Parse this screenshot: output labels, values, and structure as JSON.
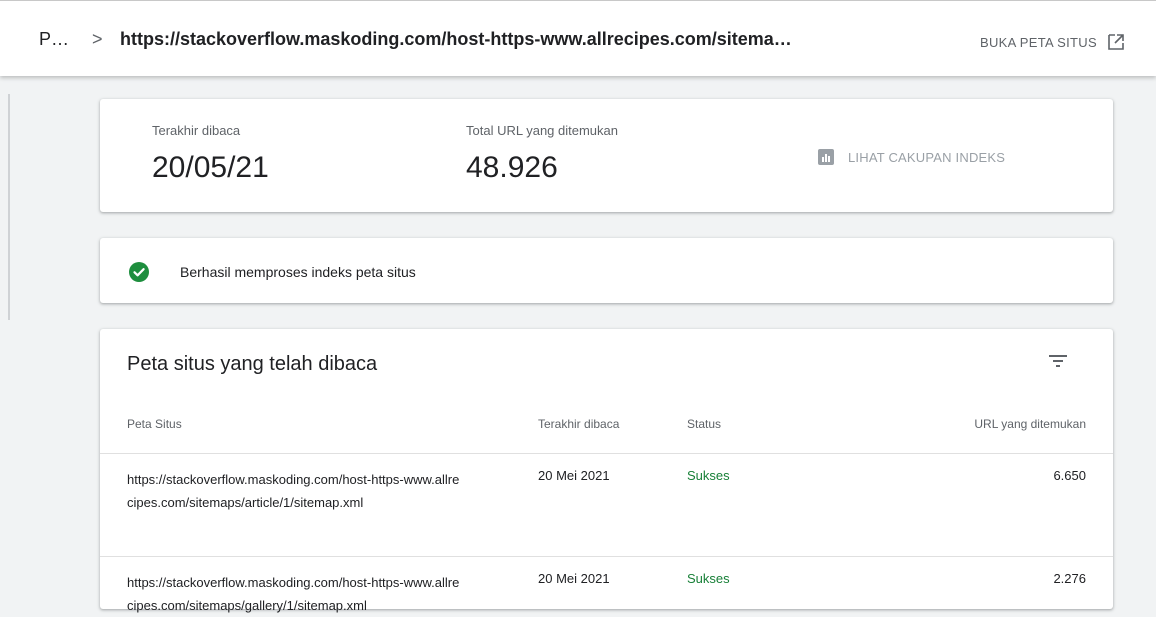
{
  "header": {
    "crumb_short": "P…",
    "crumb_separator": ">",
    "crumb_url": "https://stackoverflow.maskoding.com/host-https-www.allrecipes.com/sitema…",
    "open_sitemap_label": "BUKA PETA SITUS",
    "open_icon": "open-in-new-icon"
  },
  "summary": {
    "last_read_label": "Terakhir dibaca",
    "last_read_value": "20/05/21",
    "total_urls_label": "Total URL yang ditemukan",
    "total_urls_value": "48.926",
    "coverage_label": "LIHAT CAKUPAN INDEKS",
    "coverage_icon": "bar-chart-icon"
  },
  "status": {
    "icon": "check-circle-icon",
    "message": "Berhasil memproses indeks peta situs",
    "color": "#1e8e3e"
  },
  "table": {
    "title": "Peta situs yang telah dibaca",
    "filter_icon": "filter-icon",
    "columns": [
      "Peta Situs",
      "Terakhir dibaca",
      "Status",
      "URL yang ditemukan"
    ],
    "rows": [
      {
        "url_line1": "https://stackoverflow.maskoding.com/host-https-www.allre",
        "url_line2": "cipes.com/sitemaps/article/1/sitemap.xml",
        "date": "20 Mei 2021",
        "status": "Sukses",
        "count": "6.650"
      },
      {
        "url_line1": "https://stackoverflow.maskoding.com/host-https-www.allre",
        "url_line2": "cipes.com/sitemaps/gallery/1/sitemap.xml",
        "date": "20 Mei 2021",
        "status": "Sukses",
        "count": "2.276"
      }
    ]
  }
}
